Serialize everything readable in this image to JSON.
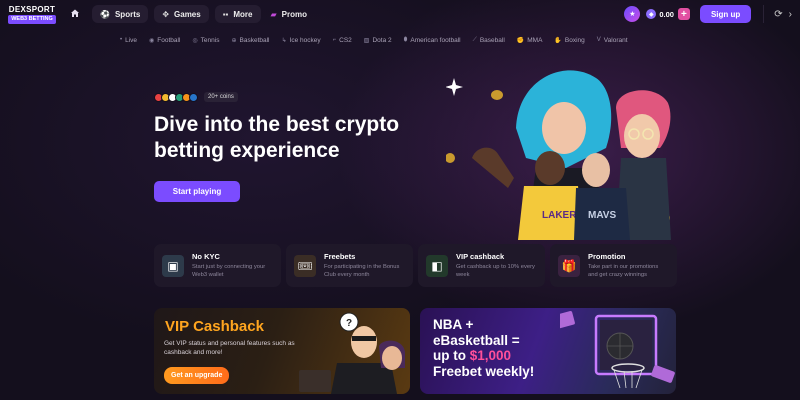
{
  "brand": {
    "name": "DEXSPORT",
    "tagline": "WEB3 BETTING"
  },
  "nav": {
    "home_icon": "home-icon",
    "items": [
      {
        "label": "Sports",
        "icon": "soccer-ball-icon"
      },
      {
        "label": "Games",
        "icon": "gamepad-icon"
      },
      {
        "label": "More",
        "icon": "grid-icon"
      },
      {
        "label": "Promo",
        "icon": "gift-icon"
      }
    ]
  },
  "account": {
    "balance": "0.00",
    "plus": "+",
    "signup_label": "Sign up"
  },
  "sports": [
    {
      "label": "Live",
      "icon": "live-dot-icon"
    },
    {
      "label": "Football",
      "icon": "soccer-ball-icon"
    },
    {
      "label": "Tennis",
      "icon": "tennis-ball-icon"
    },
    {
      "label": "Basketball",
      "icon": "basketball-icon"
    },
    {
      "label": "Ice hockey",
      "icon": "hockey-stick-icon"
    },
    {
      "label": "CS2",
      "icon": "cs2-icon"
    },
    {
      "label": "Dota 2",
      "icon": "dota-icon"
    },
    {
      "label": "American football",
      "icon": "american-football-icon"
    },
    {
      "label": "Baseball",
      "icon": "baseball-icon"
    },
    {
      "label": "MMA",
      "icon": "mma-glove-icon"
    },
    {
      "label": "Boxing",
      "icon": "boxing-glove-icon"
    },
    {
      "label": "Valorant",
      "icon": "valorant-icon"
    }
  ],
  "hero": {
    "coins_badge": "20+ coins",
    "title": "Dive into the best crypto betting experience",
    "cta_label": "Start playing"
  },
  "features": [
    {
      "title": "No KYC",
      "desc": "Start just by connecting your Web3 wallet",
      "icon": "wallet-icon",
      "color": "#2d3a4a"
    },
    {
      "title": "Freebets",
      "desc": "For participating in the Bonus Club every month",
      "icon": "ticket-icon",
      "color": "#3a2d25"
    },
    {
      "title": "VIP cashback",
      "desc": "Get cashback up to 10% every week",
      "icon": "cashback-icon",
      "color": "#22392b"
    },
    {
      "title": "Promotion",
      "desc": "Take part in our promotions and get crazy winnings",
      "icon": "gift-icon",
      "color": "#3a2240"
    }
  ],
  "promos": {
    "vip": {
      "title": "VIP Cashback",
      "desc": "Get VIP status and personal features such as cashback and more!",
      "button": "Get an upgrade"
    },
    "nba": {
      "line1": "NBA +",
      "line2": "eBasketball =",
      "line3_prefix": "up to ",
      "line3_amount": "$1,000",
      "line4": "Freebet weekly!"
    }
  },
  "colors": {
    "accent": "#7b4cff",
    "orange": "#ffa51f",
    "pink": "#ff4f9a",
    "background": "#140f1d"
  }
}
